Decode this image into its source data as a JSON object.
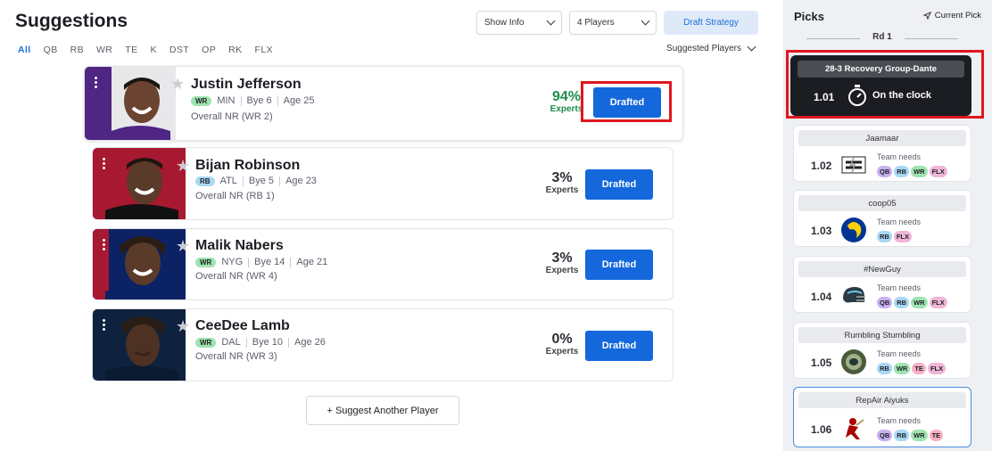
{
  "header": {
    "title": "Suggestions",
    "show_info_label": "Show Info",
    "players_select_label": "4 Players",
    "strategy_button": "Draft Strategy",
    "suggested_players_label": "Suggested Players"
  },
  "filters": [
    "All",
    "QB",
    "RB",
    "WR",
    "TE",
    "K",
    "DST",
    "OP",
    "RK",
    "FLX"
  ],
  "active_filter": "All",
  "players": [
    {
      "name": "Justin Jefferson",
      "pos": "WR",
      "team": "MIN",
      "bye": "Bye 6",
      "age": "Age 25",
      "overall": "Overall NR (WR 2)",
      "pct": "94%",
      "pct_label": "Experts",
      "button": "Drafted"
    },
    {
      "name": "Bijan Robinson",
      "pos": "RB",
      "team": "ATL",
      "bye": "Bye 5",
      "age": "Age 23",
      "overall": "Overall NR (RB 1)",
      "pct": "3%",
      "pct_label": "Experts",
      "button": "Drafted"
    },
    {
      "name": "Malik Nabers",
      "pos": "WR",
      "team": "NYG",
      "bye": "Bye 14",
      "age": "Age 21",
      "overall": "Overall NR (WR 4)",
      "pct": "3%",
      "pct_label": "Experts",
      "button": "Drafted"
    },
    {
      "name": "CeeDee Lamb",
      "pos": "WR",
      "team": "DAL",
      "bye": "Bye 10",
      "age": "Age 26",
      "overall": "Overall NR (WR 3)",
      "pct": "0%",
      "pct_label": "Experts",
      "button": "Drafted"
    }
  ],
  "suggest_button": "+ Suggest Another Player",
  "sidebar": {
    "title": "Picks",
    "current_pick_label": "Current Pick",
    "round_label": "Rd 1",
    "on_clock": {
      "team": "28-3 Recovery Group-Dante",
      "pick": "1.01",
      "status": "On the clock"
    },
    "needs_label": "Team needs",
    "picks": [
      {
        "team": "Jaamaar",
        "pick": "1.02",
        "needs": [
          "QB",
          "RB",
          "WR",
          "FLX"
        ],
        "logo": "bolt-gang-logo"
      },
      {
        "team": "coop05",
        "pick": "1.03",
        "needs": [
          "RB",
          "FLX"
        ],
        "logo": "rams-logo"
      },
      {
        "team": "#NewGuy",
        "pick": "1.04",
        "needs": [
          "QB",
          "RB",
          "WR",
          "FLX"
        ],
        "logo": "helmet-logo"
      },
      {
        "team": "Rumbling Stumbling",
        "pick": "1.05",
        "needs": [
          "RB",
          "WR",
          "TE",
          "FLX"
        ],
        "logo": "packers-logo"
      },
      {
        "team": "RepAir Aiyuks",
        "pick": "1.06",
        "needs": [
          "QB",
          "RB",
          "WR",
          "TE"
        ],
        "logo": "49ers-logo"
      }
    ]
  },
  "colors": {
    "accent": "#1468dc",
    "highlight": "#e0161e",
    "expert_green": "#1e8d4c"
  }
}
